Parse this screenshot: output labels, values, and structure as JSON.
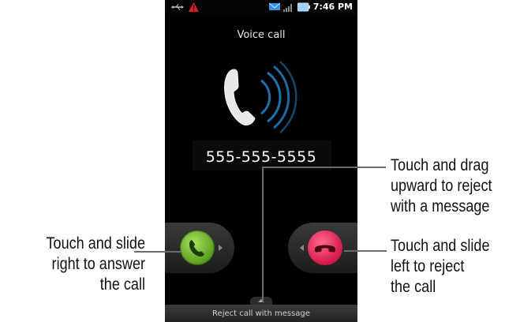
{
  "status_bar": {
    "time": "7:46 PM",
    "icons": [
      "usb-icon",
      "alert-icon",
      "message-icon",
      "signal-icon",
      "battery-icon"
    ]
  },
  "call": {
    "title": "Voice call",
    "number": "555-555-5555"
  },
  "controls": {
    "answer_icon": "phone-answer-icon",
    "reject_icon": "phone-reject-icon",
    "reject_message_label": "Reject call with message"
  },
  "callouts": {
    "left": [
      "Touch and slide",
      "right to answer",
      "the call"
    ],
    "right_top": [
      "Touch and drag",
      "upward to reject",
      "with a message"
    ],
    "right_bottom": [
      "Touch and slide",
      "left to reject",
      "the call"
    ]
  },
  "colors": {
    "answer": "#6fb82a",
    "reject": "#e3245a",
    "wave": "#2a8fd6",
    "background": "#000000"
  }
}
